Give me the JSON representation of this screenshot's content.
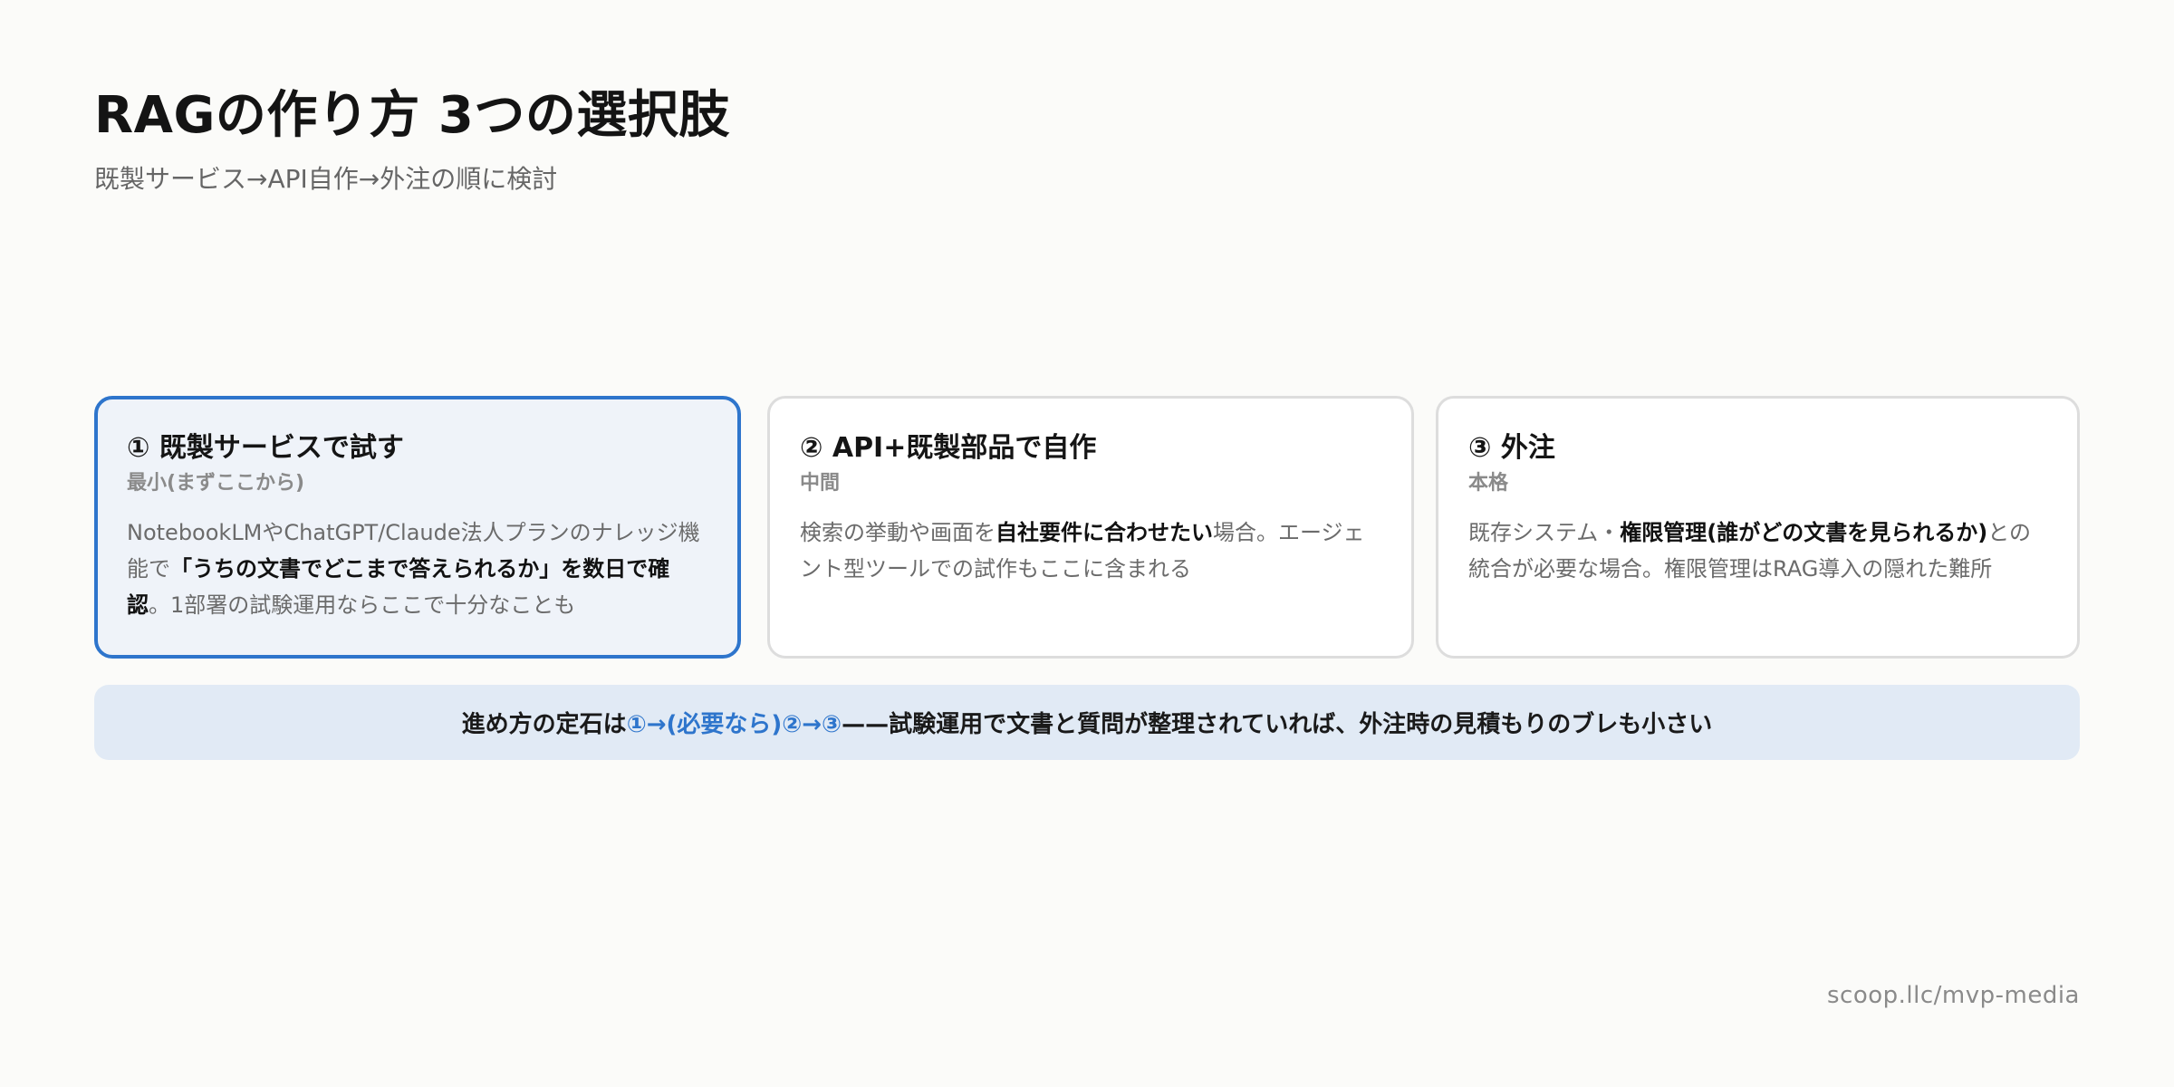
{
  "title": "RAGの作り方 3つの選択肢",
  "subtitle": "既製サービス→API自作→外注の順に検討",
  "cards": [
    {
      "title": "① 既製サービスで試す",
      "level": "最小(まずここから)",
      "body": [
        {
          "text": "NotebookLMやChatGPT/Claude法人プランのナレッジ機能で",
          "bold": false
        },
        {
          "text": "「うちの文書でどこまで答えられるか」を数日で確認",
          "bold": true
        },
        {
          "text": "。1部署の試験運用ならここで十分なことも",
          "bold": false
        }
      ]
    },
    {
      "title": "② API+既製部品で自作",
      "level": "中間",
      "body": [
        {
          "text": "検索の挙動や画面を",
          "bold": false
        },
        {
          "text": "自社要件に合わせたい",
          "bold": true
        },
        {
          "text": "場合。エージェント型ツールでの試作もここに含まれる",
          "bold": false
        }
      ]
    },
    {
      "title": "③ 外注",
      "level": "本格",
      "body": [
        {
          "text": "既存システム・",
          "bold": false
        },
        {
          "text": "権限管理(誰がどの文書を見られるか)",
          "bold": true
        },
        {
          "text": "との統合が必要な場合。権限管理はRAG導入の隠れた難所",
          "bold": false
        }
      ]
    }
  ],
  "banner": {
    "prefix": "進め方の定石は",
    "highlight": "①→(必要なら)②→③",
    "suffix": "——試験運用で文書と質問が整理されていれば、外注時の見積もりのブレも小さい"
  },
  "footer": "scoop.llc/mvp-media",
  "colors": {
    "accent": "#2e75cc",
    "background": "#fbfbf9",
    "banner_bg": "#e1eaf5",
    "card_selected_bg": "#eff3f9"
  }
}
